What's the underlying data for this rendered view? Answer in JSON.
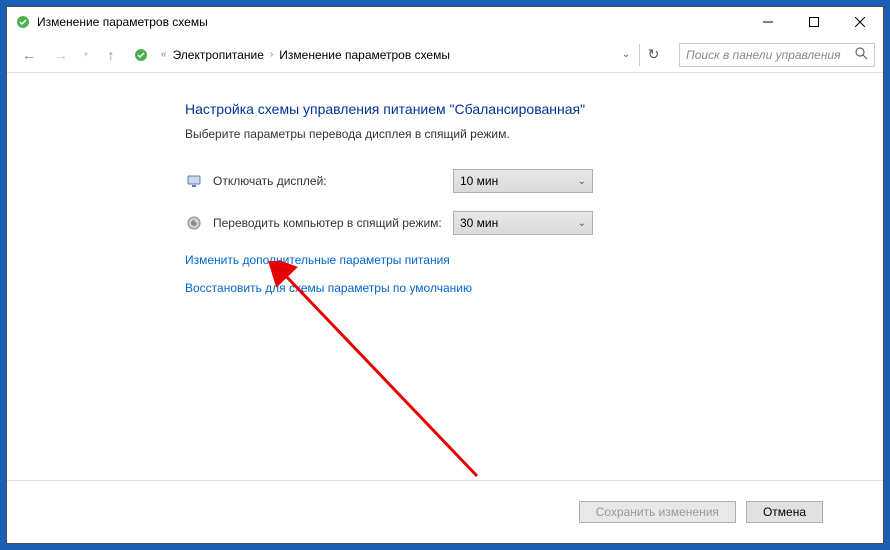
{
  "titlebar": {
    "title": "Изменение параметров схемы"
  },
  "breadcrumb": {
    "items": [
      "Электропитание",
      "Изменение параметров схемы"
    ]
  },
  "search": {
    "placeholder": "Поиск в панели управления"
  },
  "main": {
    "heading": "Настройка схемы управления питанием \"Сбалансированная\"",
    "subtext": "Выберите параметры перевода дисплея в спящий режим.",
    "settings": [
      {
        "label": "Отключать дисплей:",
        "value": "10 мин"
      },
      {
        "label": "Переводить компьютер в спящий режим:",
        "value": "30 мин"
      }
    ],
    "links": {
      "advanced": "Изменить дополнительные параметры питания",
      "restore": "Восстановить для схемы параметры по умолчанию"
    }
  },
  "footer": {
    "save": "Сохранить изменения",
    "cancel": "Отмена"
  }
}
